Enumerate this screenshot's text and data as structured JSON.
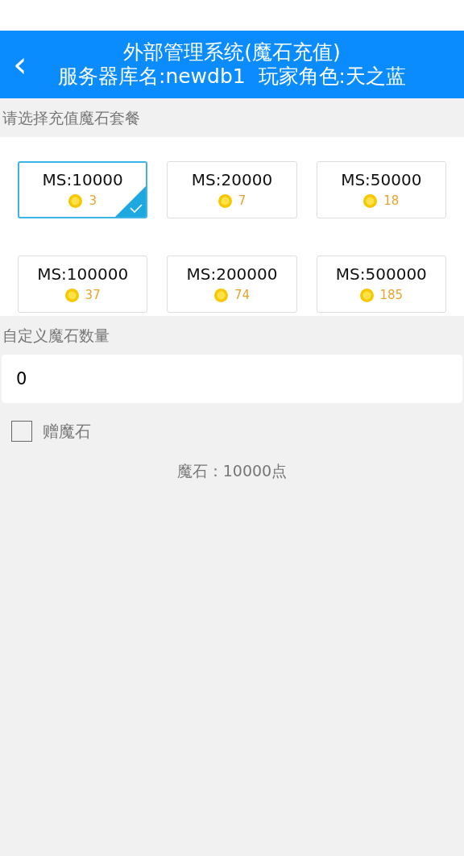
{
  "header": {
    "back": "‹",
    "title": "外部管理系统(魔石充值)",
    "subtitle": "服务器库名:newdb1  玩家角色:天之蓝"
  },
  "packages_label": "请选择充值魔石套餐",
  "packages": [
    {
      "name": "MS:10000",
      "price": "3",
      "selected": true
    },
    {
      "name": "MS:20000",
      "price": "7",
      "selected": false
    },
    {
      "name": "MS:50000",
      "price": "18",
      "selected": false
    },
    {
      "name": "MS:100000",
      "price": "37",
      "selected": false
    },
    {
      "name": "MS:200000",
      "price": "74",
      "selected": false
    },
    {
      "name": "MS:500000",
      "price": "185",
      "selected": false
    }
  ],
  "custom_label": "自定义魔石数量",
  "custom_amount": {
    "value": "0"
  },
  "bonus": {
    "label": "赠魔石",
    "checked": false
  },
  "summary": "魔石：10000点"
}
